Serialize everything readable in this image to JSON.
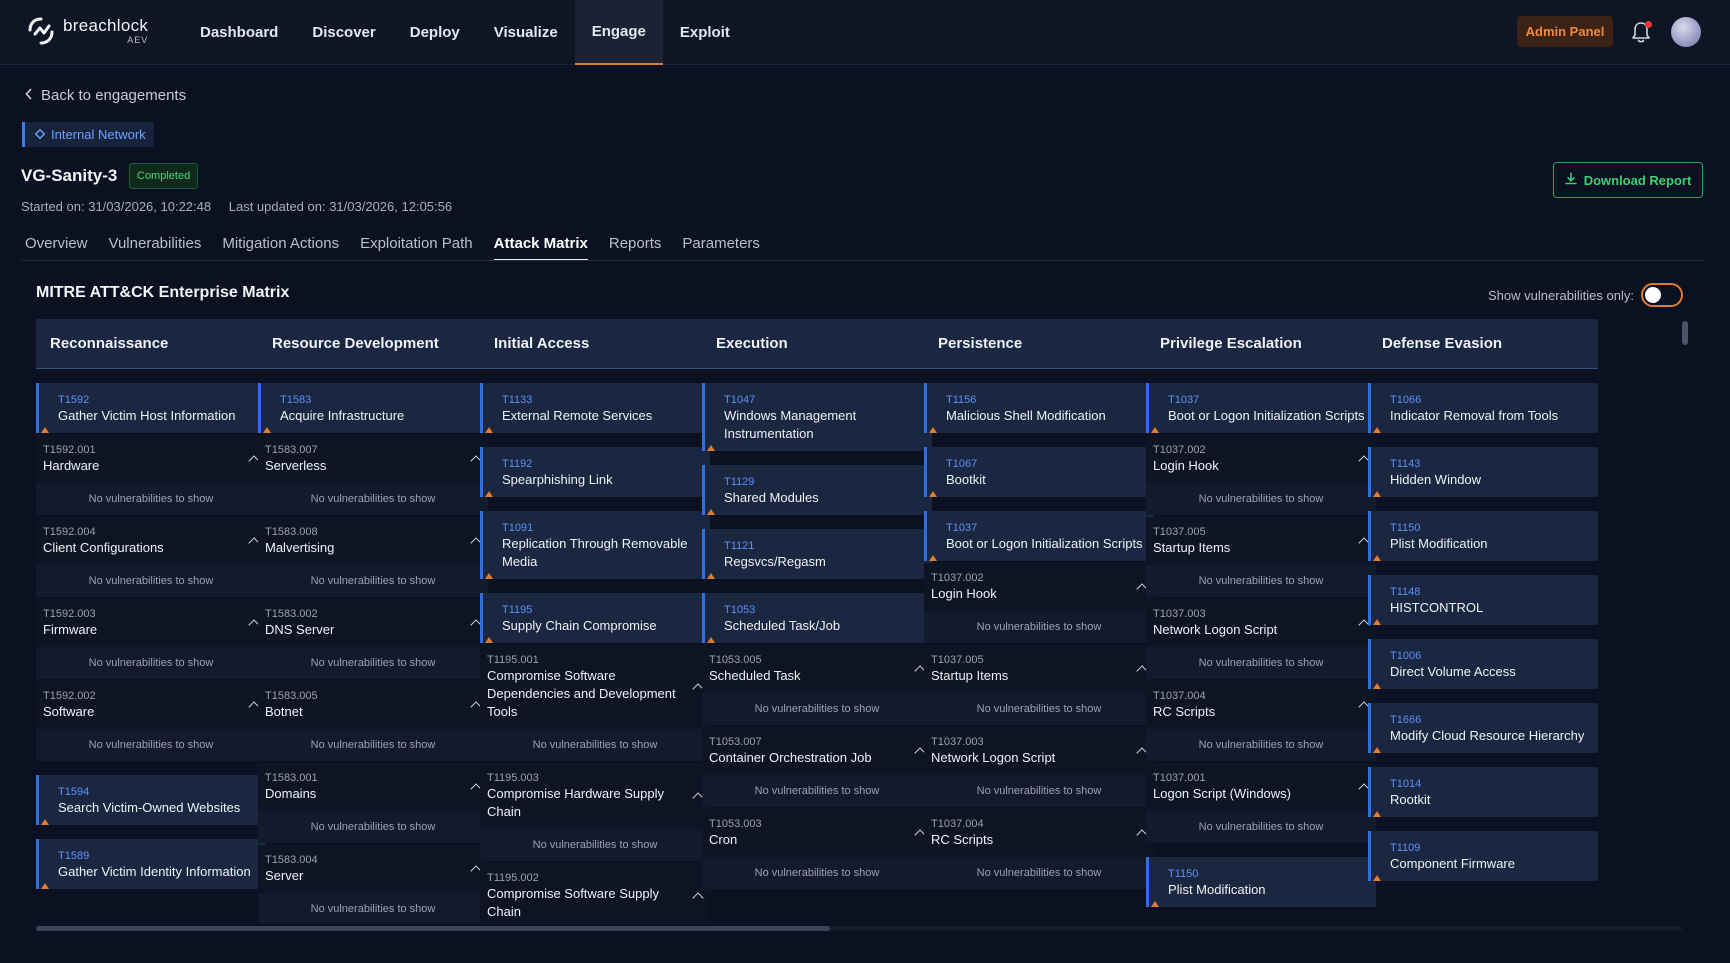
{
  "brand": {
    "name": "breachlock",
    "sub": "AEV",
    "accent": "#e07a2f"
  },
  "nav": {
    "items": [
      {
        "label": "Dashboard",
        "active": false
      },
      {
        "label": "Discover",
        "active": false
      },
      {
        "label": "Deploy",
        "active": false
      },
      {
        "label": "Visualize",
        "active": false
      },
      {
        "label": "Engage",
        "active": true
      },
      {
        "label": "Exploit",
        "active": false
      }
    ],
    "admin_label": "Admin Panel"
  },
  "header": {
    "back_label": "Back to engagements",
    "network_tag": "Internal Network",
    "title": "VG-Sanity-3",
    "status": "Completed",
    "started": "Started on: 31/03/2026, 10:22:48",
    "updated": "Last updated on: 31/03/2026, 12:05:56",
    "download_label": "Download Report"
  },
  "tabs": [
    {
      "label": "Overview",
      "active": false
    },
    {
      "label": "Vulnerabilities",
      "active": false
    },
    {
      "label": "Mitigation Actions",
      "active": false
    },
    {
      "label": "Exploitation Path",
      "active": false
    },
    {
      "label": "Attack Matrix",
      "active": true
    },
    {
      "label": "Reports",
      "active": false
    },
    {
      "label": "Parameters",
      "active": false
    }
  ],
  "matrix": {
    "title": "MITRE ATT&CK Enterprise Matrix",
    "toggle_label": "Show vulnerabilities only:",
    "toggle_on": false,
    "empty_text": "No vulnerabilities to show",
    "columns": [
      {
        "name": "Reconnaissance",
        "blocks": [
          {
            "kind": "tech",
            "id": "T1592",
            "name": "Gather Victim Host Information"
          },
          {
            "kind": "sub",
            "id": "T1592.001",
            "name": "Hardware"
          },
          {
            "kind": "sub",
            "id": "T1592.004",
            "name": "Client Configurations"
          },
          {
            "kind": "sub",
            "id": "T1592.003",
            "name": "Firmware"
          },
          {
            "kind": "sub",
            "id": "T1592.002",
            "name": "Software"
          },
          {
            "kind": "tech",
            "id": "T1594",
            "name": "Search Victim-Owned Websites"
          },
          {
            "kind": "tech",
            "id": "T1589",
            "name": "Gather Victim Identity Information"
          }
        ]
      },
      {
        "name": "Resource Development",
        "blocks": [
          {
            "kind": "tech",
            "id": "T1583",
            "name": "Acquire Infrastructure"
          },
          {
            "kind": "sub",
            "id": "T1583.007",
            "name": "Serverless"
          },
          {
            "kind": "sub",
            "id": "T1583.008",
            "name": "Malvertising"
          },
          {
            "kind": "sub",
            "id": "T1583.002",
            "name": "DNS Server"
          },
          {
            "kind": "sub",
            "id": "T1583.005",
            "name": "Botnet"
          },
          {
            "kind": "sub",
            "id": "T1583.001",
            "name": "Domains"
          },
          {
            "kind": "sub",
            "id": "T1583.004",
            "name": "Server"
          }
        ]
      },
      {
        "name": "Initial Access",
        "blocks": [
          {
            "kind": "tech",
            "id": "T1133",
            "name": "External Remote Services"
          },
          {
            "kind": "tech",
            "id": "T1192",
            "name": "Spearphishing Link"
          },
          {
            "kind": "tech",
            "id": "T1091",
            "name": "Replication Through Removable Media"
          },
          {
            "kind": "tech",
            "id": "T1195",
            "name": "Supply Chain Compromise"
          },
          {
            "kind": "sub",
            "id": "T1195.001",
            "name": "Compromise Software Dependencies and Development Tools"
          },
          {
            "kind": "sub",
            "id": "T1195.003",
            "name": "Compromise Hardware Supply Chain"
          },
          {
            "kind": "sub",
            "id": "T1195.002",
            "name": "Compromise Software Supply Chain"
          }
        ]
      },
      {
        "name": "Execution",
        "blocks": [
          {
            "kind": "tech",
            "id": "T1047",
            "name": "Windows Management Instrumentation"
          },
          {
            "kind": "tech",
            "id": "T1129",
            "name": "Shared Modules"
          },
          {
            "kind": "tech",
            "id": "T1121",
            "name": "Regsvcs/Regasm"
          },
          {
            "kind": "tech",
            "id": "T1053",
            "name": "Scheduled Task/Job"
          },
          {
            "kind": "sub",
            "id": "T1053.005",
            "name": "Scheduled Task"
          },
          {
            "kind": "sub",
            "id": "T1053.007",
            "name": "Container Orchestration Job"
          },
          {
            "kind": "sub",
            "id": "T1053.003",
            "name": "Cron"
          }
        ]
      },
      {
        "name": "Persistence",
        "blocks": [
          {
            "kind": "tech",
            "id": "T1156",
            "name": "Malicious Shell Modification"
          },
          {
            "kind": "tech",
            "id": "T1067",
            "name": "Bootkit"
          },
          {
            "kind": "tech",
            "id": "T1037",
            "name": "Boot or Logon Initialization Scripts"
          },
          {
            "kind": "sub",
            "id": "T1037.002",
            "name": "Login Hook"
          },
          {
            "kind": "sub",
            "id": "T1037.005",
            "name": "Startup Items"
          },
          {
            "kind": "sub",
            "id": "T1037.003",
            "name": "Network Logon Script"
          },
          {
            "kind": "sub",
            "id": "T1037.004",
            "name": "RC Scripts"
          }
        ]
      },
      {
        "name": "Privilege Escalation",
        "blocks": [
          {
            "kind": "tech",
            "id": "T1037",
            "name": "Boot or Logon Initialization Scripts"
          },
          {
            "kind": "sub",
            "id": "T1037.002",
            "name": "Login Hook"
          },
          {
            "kind": "sub",
            "id": "T1037.005",
            "name": "Startup Items"
          },
          {
            "kind": "sub",
            "id": "T1037.003",
            "name": "Network Logon Script"
          },
          {
            "kind": "sub",
            "id": "T1037.004",
            "name": "RC Scripts"
          },
          {
            "kind": "sub",
            "id": "T1037.001",
            "name": "Logon Script (Windows)"
          },
          {
            "kind": "tech",
            "id": "T1150",
            "name": "Plist Modification"
          }
        ]
      },
      {
        "name": "Defense Evasion",
        "blocks": [
          {
            "kind": "tech",
            "id": "T1066",
            "name": "Indicator Removal from Tools"
          },
          {
            "kind": "tech",
            "id": "T1143",
            "name": "Hidden Window"
          },
          {
            "kind": "tech",
            "id": "T1150",
            "name": "Plist Modification"
          },
          {
            "kind": "tech",
            "id": "T1148",
            "name": "HISTCONTROL"
          },
          {
            "kind": "tech",
            "id": "T1006",
            "name": "Direct Volume Access"
          },
          {
            "kind": "tech",
            "id": "T1666",
            "name": "Modify Cloud Resource Hierarchy"
          },
          {
            "kind": "tech",
            "id": "T1014",
            "name": "Rootkit"
          },
          {
            "kind": "tech",
            "id": "T1109",
            "name": "Component Firmware"
          }
        ]
      }
    ]
  }
}
